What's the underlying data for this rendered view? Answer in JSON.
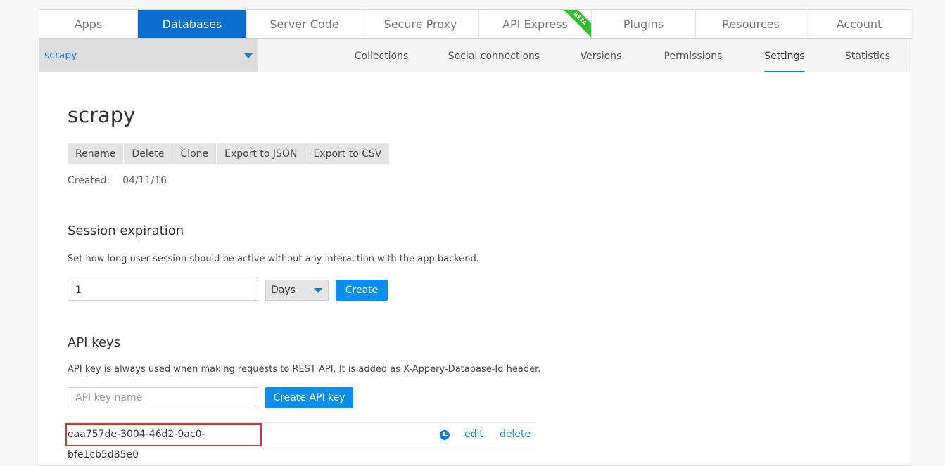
{
  "tabs": [
    {
      "label": "Apps"
    },
    {
      "label": "Databases"
    },
    {
      "label": "Server Code"
    },
    {
      "label": "Secure Proxy"
    },
    {
      "label": "API Express",
      "badge": "BETA"
    },
    {
      "label": "Plugins"
    },
    {
      "label": "Resources"
    },
    {
      "label": "Account"
    }
  ],
  "database_selector": {
    "value": "scrapy"
  },
  "subnav": [
    {
      "label": "Collections"
    },
    {
      "label": "Social connections"
    },
    {
      "label": "Versions"
    },
    {
      "label": "Permissions"
    },
    {
      "label": "Settings"
    },
    {
      "label": "Statistics"
    }
  ],
  "page": {
    "title": "scrapy",
    "actions": [
      "Rename",
      "Delete",
      "Clone",
      "Export to JSON",
      "Export to CSV"
    ],
    "created_label": "Created:",
    "created_value": "04/11/16"
  },
  "session": {
    "heading": "Session expiration",
    "description": "Set how long user session should be active without any interaction with the app backend.",
    "value": "1",
    "unit": "Days",
    "button": "Create"
  },
  "api_keys": {
    "heading": "API keys",
    "description": "API key is always used when making requests to REST API. It is added as X-Appery-Database-Id header.",
    "placeholder": "API key name",
    "button": "Create API key",
    "keys": [
      {
        "key": "eaa757de-3004-46d2-9ac0-bfe1cb5d85e0",
        "edit": "edit",
        "delete": "delete"
      }
    ]
  },
  "colors": {
    "accent": "#0a6fd1",
    "button": "#0a8ff0",
    "beta": "#2fc12a",
    "highlight": "#e03030"
  }
}
